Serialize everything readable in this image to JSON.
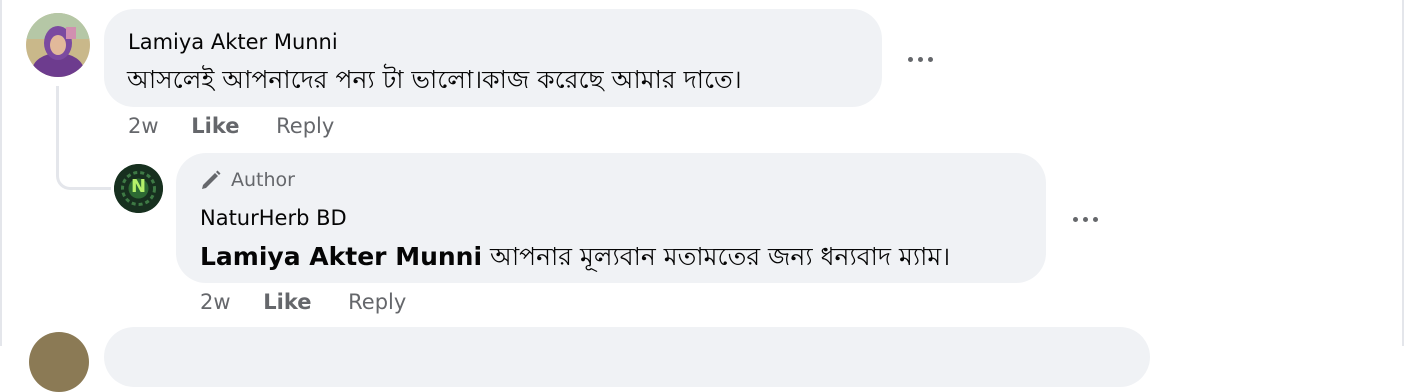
{
  "comments": [
    {
      "author": "Lamiya Akter Munni",
      "text": "আসলেই আপনাদের পন্য টা ভালো।কাজ করেছে আমার দাতে।",
      "time": "2w",
      "like_label": "Like",
      "reply_label": "Reply",
      "avatar_icon": "profile-photo-woman-hijab"
    }
  ],
  "replies": [
    {
      "badge": "Author",
      "author": "NaturHerb BD",
      "mention": "Lamiya Akter Munni",
      "text": " আপনার মূল্যবান মতামতের জন্য ধন্যবাদ ম্যাম।",
      "time": "2w",
      "like_label": "Like",
      "reply_label": "Reply",
      "avatar_icon": "naturherb-logo",
      "avatar_letter": "N"
    }
  ],
  "colors": {
    "bubble": "#f0f2f5",
    "meta_text": "#65676b",
    "body_text": "#050505"
  }
}
